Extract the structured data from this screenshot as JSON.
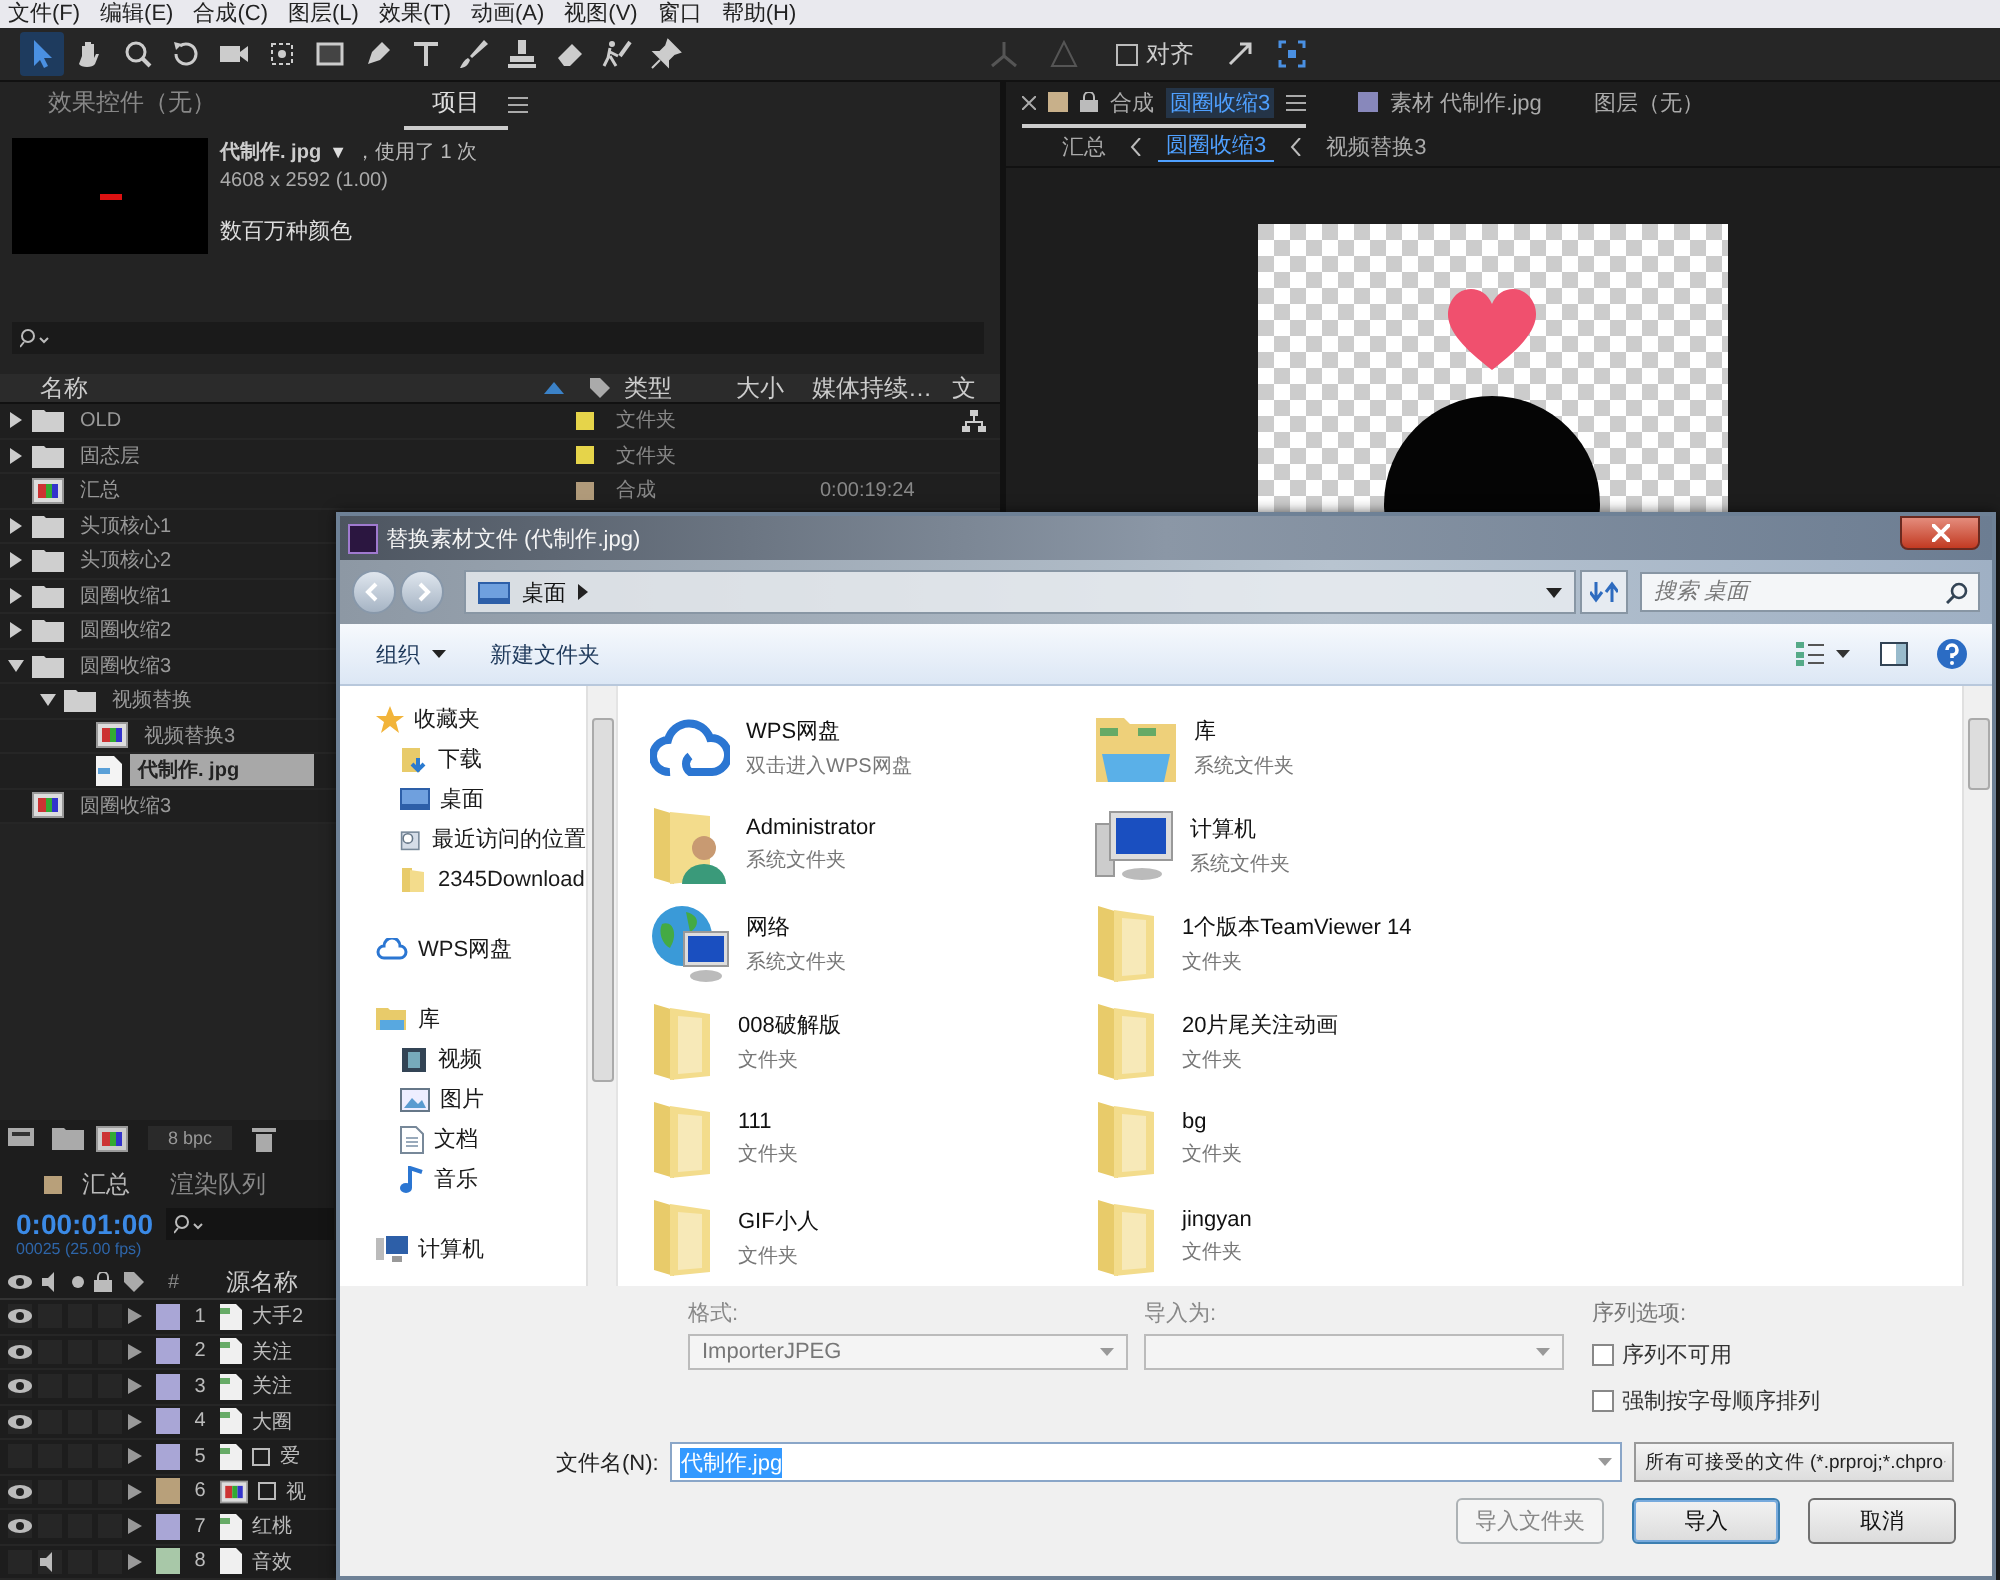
{
  "menu_bar": [
    "文件(F)",
    "编辑(E)",
    "合成(C)",
    "图层(L)",
    "效果(T)",
    "动画(A)",
    "视图(V)",
    "窗口",
    "帮助(H)"
  ],
  "toolbar": {
    "tools": [
      {
        "kind": "select",
        "selected": true
      },
      {
        "kind": "hand",
        "selected": false
      },
      {
        "kind": "zoom",
        "selected": false
      },
      {
        "kind": "rotate",
        "selected": false
      },
      {
        "kind": "camera",
        "selected": false
      },
      {
        "kind": "pan",
        "selected": false
      },
      {
        "kind": "rect",
        "selected": false
      },
      {
        "kind": "pen",
        "selected": false
      },
      {
        "kind": "text",
        "selected": false
      },
      {
        "kind": "brush",
        "selected": false
      },
      {
        "kind": "stamp",
        "selected": false
      },
      {
        "kind": "eraser",
        "selected": false
      },
      {
        "kind": "roto",
        "selected": false
      },
      {
        "kind": "pin",
        "selected": false
      }
    ],
    "snap": {
      "label": "对齐",
      "checked": false
    }
  },
  "project": {
    "tabs": [
      {
        "label": "效果控件（无）",
        "selected": false
      },
      {
        "label": "项目",
        "selected": true
      }
    ],
    "preview": {
      "name": "代制作. jpg",
      "dropdown": "▼",
      "usage": "，使用了 1 次",
      "dimensions": "4608 x 2592 (1.00)",
      "colors": "数百万种颜色"
    },
    "columns": [
      "名称",
      "类型",
      "大小",
      "媒体持续…",
      "文"
    ],
    "rows": [
      {
        "name": "OLD",
        "kind": "folder",
        "expanded": false,
        "selected": false,
        "color": "#e6d44a",
        "type": "文件夹"
      },
      {
        "name": "固态层",
        "kind": "folder",
        "expanded": false,
        "selected": false,
        "color": "#e6d44a",
        "type": "文件夹"
      },
      {
        "name": "汇总",
        "kind": "comp",
        "selected": false,
        "color": "#b09a7a",
        "type": "合成",
        "duration": "0:00:19:24"
      },
      {
        "name": "头顶核心1",
        "kind": "folder",
        "expanded": false,
        "selected": false
      },
      {
        "name": "头顶核心2",
        "kind": "folder",
        "expanded": false,
        "selected": false
      },
      {
        "name": "圆圈收缩1",
        "kind": "folder",
        "expanded": false,
        "selected": false
      },
      {
        "name": "圆圈收缩2",
        "kind": "folder",
        "expanded": false,
        "selected": false
      },
      {
        "name": "圆圈收缩3",
        "kind": "folder",
        "expanded": true,
        "selected": false,
        "children": [
          {
            "name": "视频替换",
            "kind": "folder",
            "expanded": true,
            "selected": false,
            "children": [
              {
                "name": "视频替换3",
                "kind": "comp",
                "selected": false
              },
              {
                "name": "代制作. jpg",
                "kind": "footage",
                "selected": true
              }
            ]
          }
        ]
      },
      {
        "name": "圆圈收缩3",
        "kind": "comp",
        "selected": false
      }
    ],
    "bit_depth": "8 bpc"
  },
  "timeline": {
    "tabs": [
      {
        "label": "汇总",
        "selected": true,
        "color": "#b8a07a"
      },
      {
        "label": "渲染队列",
        "selected": false
      }
    ],
    "timecode": "0:00:01:00",
    "frame_info": "00025 (25.00 fps)",
    "columns": [
      "#",
      "源名称"
    ],
    "layers": [
      {
        "number": "1",
        "name": "大手2",
        "kind": "footage",
        "visible": true,
        "audio": false,
        "solo": false,
        "locked": false,
        "switch": false,
        "color": "#a9a6d6"
      },
      {
        "number": "2",
        "name": "关注",
        "kind": "footage",
        "visible": true,
        "audio": false,
        "solo": false,
        "locked": false,
        "switch": false,
        "color": "#a9a6d6"
      },
      {
        "number": "3",
        "name": "关注",
        "kind": "footage",
        "visible": true,
        "audio": false,
        "solo": false,
        "locked": false,
        "switch": false,
        "color": "#a9a6d6"
      },
      {
        "number": "4",
        "name": "大圈",
        "kind": "footage",
        "visible": true,
        "audio": false,
        "solo": false,
        "locked": false,
        "switch": false,
        "color": "#a9a6d6"
      },
      {
        "number": "5",
        "name": "爱",
        "kind": "footage",
        "visible": false,
        "audio": false,
        "solo": false,
        "locked": false,
        "switch": true,
        "color": "#a9a6d6"
      },
      {
        "number": "6",
        "name": "视",
        "kind": "comp",
        "visible": true,
        "audio": false,
        "solo": false,
        "locked": false,
        "switch": true,
        "color": "#b8a07a"
      },
      {
        "number": "7",
        "name": "红桃",
        "kind": "footage",
        "visible": true,
        "audio": false,
        "solo": false,
        "locked": false,
        "switch": false,
        "color": "#a9a6d6"
      },
      {
        "number": "8",
        "name": "音效",
        "kind": "audio",
        "visible": false,
        "audio": true,
        "solo": false,
        "locked": false,
        "switch": false,
        "color": "#a8c8a8"
      }
    ]
  },
  "viewer": {
    "tabs": [
      {
        "kind": "comp",
        "label": "合成",
        "name": "圆圈收缩3",
        "selected": true
      },
      {
        "kind": "footage",
        "label": "素材 代制作.jpg",
        "selected": false
      },
      {
        "kind": "layer",
        "label": "图层（无）",
        "selected": false
      }
    ],
    "breadcrumbs": [
      {
        "label": "汇总",
        "selected": false
      },
      {
        "label": "圆圈收缩3",
        "selected": true
      },
      {
        "label": "视频替换3",
        "selected": false
      }
    ]
  },
  "dialog": {
    "title": "替换素材文件 (代制作.jpg)",
    "address": "桌面",
    "search_placeholder": "搜索 桌面",
    "toolbar": [
      "组织",
      "新建文件夹"
    ],
    "nav": [
      {
        "label": "收藏夹",
        "kind": "star",
        "items": [
          {
            "label": "下载",
            "kind": "download"
          },
          {
            "label": "桌面",
            "kind": "desktop"
          },
          {
            "label": "最近访问的位置",
            "kind": "recent"
          },
          {
            "label": "2345Download",
            "kind": "folder"
          }
        ]
      },
      {
        "label": "WPS网盘",
        "kind": "cloud"
      },
      {
        "label": "库",
        "kind": "library",
        "items": [
          {
            "label": "视频",
            "kind": "video"
          },
          {
            "label": "图片",
            "kind": "picture"
          },
          {
            "label": "文档",
            "kind": "document"
          },
          {
            "label": "音乐",
            "kind": "music"
          }
        ]
      },
      {
        "label": "计算机",
        "kind": "computer"
      }
    ],
    "files": [
      {
        "name": "WPS网盘",
        "detail": "双击进入WPS网盘",
        "kind": "cloud"
      },
      {
        "name": "库",
        "detail": "系统文件夹",
        "kind": "library"
      },
      {
        "name": "Administrator",
        "detail": "系统文件夹",
        "kind": "user"
      },
      {
        "name": "计算机",
        "detail": "系统文件夹",
        "kind": "computer"
      },
      {
        "name": "网络",
        "detail": "系统文件夹",
        "kind": "network"
      },
      {
        "name": "1个版本TeamViewer 14",
        "detail": "文件夹",
        "kind": "folder"
      },
      {
        "name": "008破解版",
        "detail": "文件夹",
        "kind": "folder"
      },
      {
        "name": "20片尾关注动画",
        "detail": "文件夹",
        "kind": "folder"
      },
      {
        "name": "111",
        "detail": "文件夹",
        "kind": "folder"
      },
      {
        "name": "bg",
        "detail": "文件夹",
        "kind": "folder"
      },
      {
        "name": "GIF小人",
        "detail": "文件夹",
        "kind": "folder"
      },
      {
        "name": "jingyan",
        "detail": "文件夹",
        "kind": "folder"
      }
    ],
    "format": {
      "label": "格式:",
      "value": "ImporterJPEG",
      "disabled": true
    },
    "import_as": {
      "label": "导入为:",
      "disabled": true
    },
    "sequence": {
      "label": "序列选项:",
      "options": [
        {
          "label": "序列不可用",
          "checked": false
        },
        {
          "label": "强制按字母顺序排列",
          "checked": false
        }
      ]
    },
    "filename": {
      "label": "文件名(N):",
      "value": "代制作.jpg"
    },
    "filter": "所有可接受的文件 (*.prproj;*.chpro",
    "buttons": [
      {
        "label": "导入文件夹",
        "disabled": true,
        "default": false
      },
      {
        "label": "导入",
        "disabled": false,
        "default": true
      },
      {
        "label": "取消",
        "disabled": false,
        "default": false
      }
    ]
  }
}
